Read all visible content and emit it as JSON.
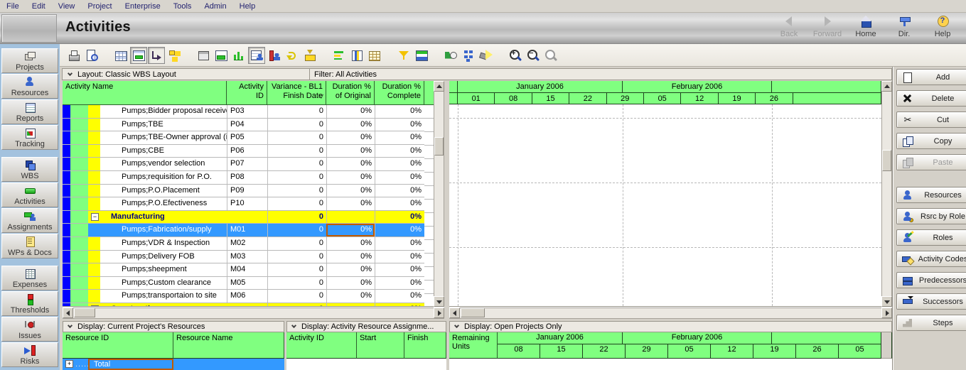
{
  "menu": [
    "File",
    "Edit",
    "View",
    "Project",
    "Enterprise",
    "Tools",
    "Admin",
    "Help"
  ],
  "header": {
    "title": "Activities"
  },
  "nav": [
    {
      "label": "Back",
      "icon": "back-arrow",
      "disabled": true
    },
    {
      "label": "Forward",
      "icon": "forward-arrow",
      "disabled": true
    },
    {
      "label": "Home",
      "icon": "home",
      "disabled": false
    },
    {
      "label": "Dir.",
      "icon": "directory",
      "disabled": false
    },
    {
      "label": "Help",
      "icon": "help",
      "disabled": false
    }
  ],
  "toolbar": [
    {
      "name": "print"
    },
    {
      "name": "print-preview"
    },
    {
      "name": "table",
      "group": true
    },
    {
      "name": "gantt-layout",
      "pressed": true
    },
    {
      "name": "trace-logic",
      "pressed": true
    },
    {
      "name": "activity-network"
    },
    {
      "name": "top-window",
      "group": true
    },
    {
      "name": "gantt-chart"
    },
    {
      "name": "profile"
    },
    {
      "name": "resource-table",
      "pressed": true
    },
    {
      "name": "resource-profile"
    },
    {
      "name": "reorganize"
    },
    {
      "name": "spreadsheet"
    },
    {
      "name": "group-sort",
      "group": true
    },
    {
      "name": "columns"
    },
    {
      "name": "table-format"
    },
    {
      "name": "filter",
      "group": true
    },
    {
      "name": "layout-options"
    },
    {
      "name": "schedule",
      "group": true
    },
    {
      "name": "global-change"
    },
    {
      "name": "spotlight"
    },
    {
      "name": "zoom-in",
      "group": true
    },
    {
      "name": "zoom-out"
    },
    {
      "name": "zoom-reset",
      "disabled": true
    }
  ],
  "layout_bar": {
    "layout_label": "Layout: Classic WBS Layout",
    "filter_label": "Filter: All Activities"
  },
  "activity_table": {
    "columns": [
      "Activity Name",
      "Activity ID",
      "Variance - BL1 Finish Date",
      "Duration % of Original",
      "Duration % Complete"
    ],
    "rows": [
      {
        "type": "activity",
        "name": "Pumps;Bidder proposal received",
        "id": "P03",
        "variance": "0",
        "dur_original": "0%",
        "dur_complete": "0%"
      },
      {
        "type": "activity",
        "name": "Pumps;TBE",
        "id": "P04",
        "variance": "0",
        "dur_original": "0%",
        "dur_complete": "0%"
      },
      {
        "type": "activity",
        "name": "Pumps;TBE-Owner approval (if a",
        "id": "P05",
        "variance": "0",
        "dur_original": "0%",
        "dur_complete": "0%"
      },
      {
        "type": "activity",
        "name": "Pumps;CBE",
        "id": "P06",
        "variance": "0",
        "dur_original": "0%",
        "dur_complete": "0%"
      },
      {
        "type": "activity",
        "name": "Pumps;vendor selection",
        "id": "P07",
        "variance": "0",
        "dur_original": "0%",
        "dur_complete": "0%"
      },
      {
        "type": "activity",
        "name": "Pumps;requisition for P.O.",
        "id": "P08",
        "variance": "0",
        "dur_original": "0%",
        "dur_complete": "0%"
      },
      {
        "type": "activity",
        "name": "Pumps;P.O.Placement",
        "id": "P09",
        "variance": "0",
        "dur_original": "0%",
        "dur_complete": "0%"
      },
      {
        "type": "activity",
        "name": "Pumps;P.O.Efectiveness",
        "id": "P10",
        "variance": "0",
        "dur_original": "0%",
        "dur_complete": "0%"
      },
      {
        "type": "group",
        "name": "Manufacturing",
        "variance": "0",
        "dur_original": "",
        "dur_complete": "0%"
      },
      {
        "type": "activity",
        "selected": true,
        "name": "Pumps;Fabrication/supply",
        "id": "M01",
        "variance": "0",
        "dur_original": "0%",
        "dur_complete": "0%"
      },
      {
        "type": "activity",
        "name": "Pumps;VDR & Inspection",
        "id": "M02",
        "variance": "0",
        "dur_original": "0%",
        "dur_complete": "0%"
      },
      {
        "type": "activity",
        "name": "Pumps;Delivery FOB",
        "id": "M03",
        "variance": "0",
        "dur_original": "0%",
        "dur_complete": "0%"
      },
      {
        "type": "activity",
        "name": "Pumps;sheepment",
        "id": "M04",
        "variance": "0",
        "dur_original": "0%",
        "dur_complete": "0%"
      },
      {
        "type": "activity",
        "name": "Pumps;Custom clearance",
        "id": "M05",
        "variance": "0",
        "dur_original": "0%",
        "dur_complete": "0%"
      },
      {
        "type": "activity",
        "name": "Pumps;transportaion to site",
        "id": "M06",
        "variance": "0",
        "dur_original": "0%",
        "dur_complete": "0%"
      },
      {
        "type": "group",
        "name": "Constructin",
        "variance": "0",
        "dur_original": "",
        "dur_complete": "0%"
      }
    ]
  },
  "gantt": {
    "months": [
      {
        "label": "January 2006"
      },
      {
        "label": "February 2006"
      },
      {
        "label": ""
      }
    ],
    "weeks": [
      "01",
      "08",
      "15",
      "22",
      "29",
      "05",
      "12",
      "19",
      "26"
    ]
  },
  "action_buttons": [
    {
      "label": "Add",
      "icon": "add"
    },
    {
      "label": "Delete",
      "icon": "delete"
    },
    {
      "label": "Cut",
      "icon": "cut"
    },
    {
      "label": "Copy",
      "icon": "copy"
    },
    {
      "label": "Paste",
      "icon": "paste",
      "disabled": true
    },
    {
      "label": "Resources",
      "icon": "resources",
      "gap": true
    },
    {
      "label": "Rsrc by Role",
      "icon": "rsrc-by-role"
    },
    {
      "label": "Roles",
      "icon": "roles"
    },
    {
      "label": "Activity Codes",
      "icon": "activity-codes"
    },
    {
      "label": "Predecessors",
      "icon": "predecessors"
    },
    {
      "label": "Successors",
      "icon": "successors"
    },
    {
      "label": "Steps",
      "icon": "steps"
    }
  ],
  "bottom": {
    "resources_panel": {
      "title": "Display: Current Project's Resources",
      "columns": [
        "Resource ID",
        "Resource Name"
      ],
      "total_row": {
        "label": "Total"
      }
    },
    "assignments_panel": {
      "title": "Display: Activity Resource Assignme...",
      "columns": [
        "Activity ID",
        "Start",
        "Finish"
      ]
    },
    "usage_panel": {
      "title": "Display: Open Projects Only",
      "units_label": "Remaining Units",
      "months": [
        {
          "label": "January 2006"
        },
        {
          "label": "February 2006"
        },
        {
          "label": ""
        }
      ],
      "weeks": [
        "08",
        "15",
        "22",
        "29",
        "05",
        "12",
        "19",
        "26",
        "05"
      ]
    }
  },
  "sidebar": {
    "groups": [
      [
        {
          "label": "Projects",
          "icon": "projects"
        },
        {
          "label": "Resources",
          "icon": "resources"
        },
        {
          "label": "Reports",
          "icon": "reports"
        },
        {
          "label": "Tracking",
          "icon": "tracking"
        }
      ],
      [
        {
          "label": "WBS",
          "icon": "wbs"
        },
        {
          "label": "Activities",
          "icon": "activities"
        },
        {
          "label": "Assignments",
          "icon": "assignments"
        },
        {
          "label": "WPs & Docs",
          "icon": "wps-docs"
        }
      ],
      [
        {
          "label": "Expenses",
          "icon": "expenses"
        },
        {
          "label": "Thresholds",
          "icon": "thresholds"
        },
        {
          "label": "Issues",
          "icon": "issues"
        },
        {
          "label": "Risks",
          "icon": "risks"
        }
      ]
    ]
  },
  "colors": {
    "header_green": "#80ff80",
    "group_yellow": "#ffff00",
    "band_blue": "#0000ff",
    "band_green": "#80ff80",
    "selection_blue": "#3399ff",
    "selection_border_orange": "#c05a00"
  }
}
